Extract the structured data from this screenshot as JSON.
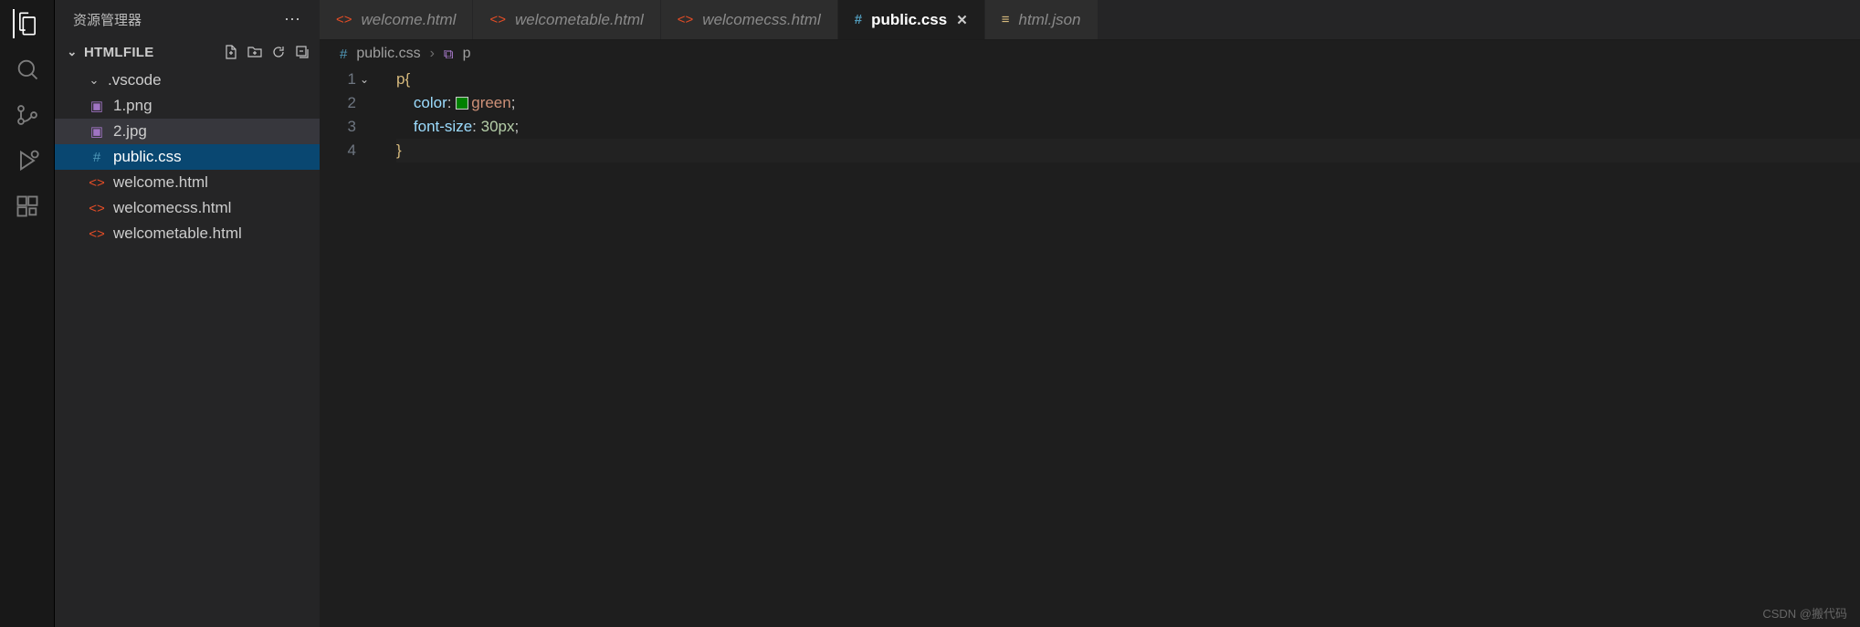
{
  "sidebar": {
    "title": "资源管理器",
    "section": "HTMLFILE",
    "folder": ".vscode",
    "files": [
      {
        "name": "1.png",
        "icon": "img"
      },
      {
        "name": "2.jpg",
        "icon": "img"
      },
      {
        "name": "public.css",
        "icon": "css"
      },
      {
        "name": "welcome.html",
        "icon": "html"
      },
      {
        "name": "welcomecss.html",
        "icon": "html"
      },
      {
        "name": "welcometable.html",
        "icon": "html"
      }
    ]
  },
  "tabs": [
    {
      "label": "welcome.html",
      "icon": "html",
      "active": false
    },
    {
      "label": "welcometable.html",
      "icon": "html",
      "active": false
    },
    {
      "label": "welcomecss.html",
      "icon": "html",
      "active": false
    },
    {
      "label": "public.css",
      "icon": "css",
      "active": true
    },
    {
      "label": "html.json",
      "icon": "json",
      "active": false
    }
  ],
  "breadcrumbs": {
    "file": "public.css",
    "symbol": "p"
  },
  "editor": {
    "lines": [
      "1",
      "2",
      "3",
      "4"
    ],
    "code": {
      "l1_sel": "p",
      "l1_brace": "{",
      "l2_prop": "color",
      "l2_colon": ":",
      "l2_val": "green",
      "l2_semi": ";",
      "l3_prop": "font-size",
      "l3_colon": ":",
      "l3_num": "30px",
      "l3_semi": ";",
      "l4_brace": "}"
    }
  },
  "watermark": "CSDN @搬代码"
}
